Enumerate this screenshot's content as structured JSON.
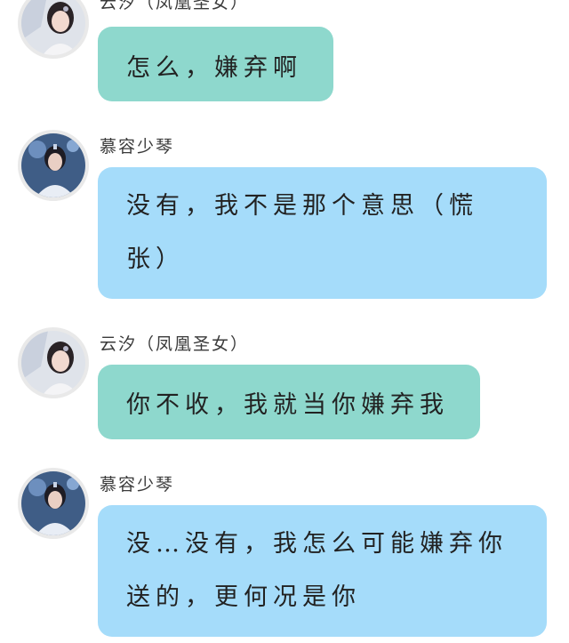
{
  "messages": [
    {
      "sender": "云汐（凤凰圣女）",
      "avatar": "female-avatar",
      "color": "#8ed8cd",
      "lines": [
        "怎么，嫌弃啊"
      ]
    },
    {
      "sender": "慕容少琴",
      "avatar": "male-avatar",
      "color": "#a5dcfa",
      "lines": [
        "没有，我不是那个意思（慌",
        "张）"
      ]
    },
    {
      "sender": "云汐（凤凰圣女）",
      "avatar": "female-avatar",
      "color": "#8ed8cd",
      "lines": [
        "你不收，我就当你嫌弃我"
      ]
    },
    {
      "sender": "慕容少琴",
      "avatar": "male-avatar",
      "color": "#a5dcfa",
      "lines": [
        "没…没有，我怎么可能嫌弃你",
        "送的，更何况是你"
      ]
    }
  ]
}
